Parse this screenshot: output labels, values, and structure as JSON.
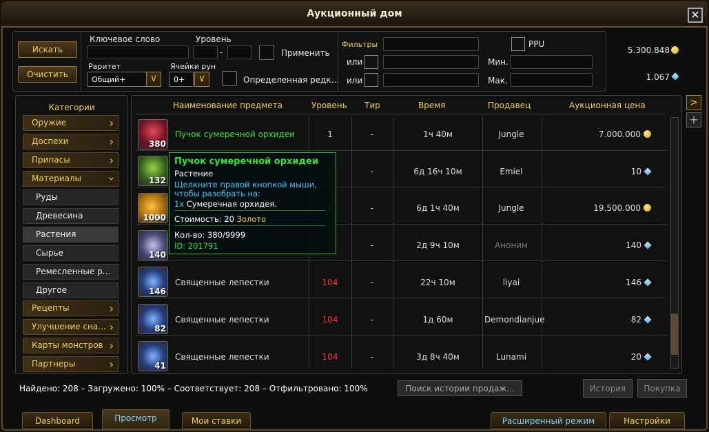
{
  "window": {
    "title": "Аукционный дом"
  },
  "search": {
    "search_btn": "Искать",
    "clear_btn": "Очистить",
    "keyword_label": "Ключевое слово",
    "keyword_value": "",
    "level_label": "Уровень",
    "level_dash": "-",
    "apply_label": "Применить",
    "rarity_label": "Раритет",
    "rarity_value": "Общий+",
    "rune_label": "Ячейки рун",
    "rune_value": "0+",
    "specific_label": "Определенная редк..."
  },
  "filters": {
    "label": "Фильтры",
    "or1": "или",
    "or2": "или",
    "ppu": "PPU",
    "min": "Мин.",
    "max": "Мак."
  },
  "currency": {
    "gold": "5.300.848",
    "gems": "1.067"
  },
  "categories": {
    "title": "Категории",
    "items": [
      {
        "label": "Оружие"
      },
      {
        "label": "Доспехи"
      },
      {
        "label": "Припасы"
      },
      {
        "label": "Материалы"
      }
    ],
    "sub": [
      {
        "label": "Руды"
      },
      {
        "label": "Древесина"
      },
      {
        "label": "Растения"
      },
      {
        "label": "Сырье"
      },
      {
        "label": "Ремесленные р..."
      },
      {
        "label": "Другое"
      }
    ],
    "after": [
      {
        "label": "Рецепты"
      },
      {
        "label": "Улучшение сна..."
      },
      {
        "label": "Карты монстров"
      },
      {
        "label": "Партнеры"
      }
    ]
  },
  "table": {
    "headers": {
      "name": "Наименование предмета",
      "level": "Уровень",
      "tier": "Тир",
      "time": "Время",
      "seller": "Продавец",
      "price": "Аукционная цена"
    },
    "rows": [
      {
        "count": "380",
        "name": "Пучок сумеречной орхидеи",
        "level": "1",
        "tier": "-",
        "time": "1ч 40м",
        "seller": "Jungle",
        "price": "7.000.000",
        "cur": "gold"
      },
      {
        "count": "132",
        "name": "",
        "level": "1",
        "tier": "-",
        "time": "6д 16ч 10м",
        "seller": "Emiel",
        "price": "10",
        "cur": "gem"
      },
      {
        "count": "1000",
        "name": "",
        "level": "1",
        "tier": "-",
        "time": "6д 1ч 40м",
        "seller": "Jungle",
        "price": "19.500.000",
        "cur": "gold"
      },
      {
        "count": "140",
        "name": "",
        "level": "1",
        "tier": "-",
        "time": "2д 9ч 10м",
        "seller": "Аноним",
        "price": "140",
        "cur": "gem"
      },
      {
        "count": "146",
        "name": "Священные лепестки",
        "level": "104",
        "tier": "-",
        "time": "22ч 10м",
        "seller": "liyai",
        "price": "146",
        "cur": "gem"
      },
      {
        "count": "82",
        "name": "Священные лепестки",
        "level": "104",
        "tier": "-",
        "time": "1д 60м",
        "seller": "Demondianjue",
        "price": "82",
        "cur": "gem"
      },
      {
        "count": "41",
        "name": "Священные лепестки",
        "level": "104",
        "tier": "-",
        "time": "3д 8ч 40м",
        "seller": "Lunami",
        "price": "20",
        "cur": "gem"
      }
    ]
  },
  "tooltip": {
    "title": "Пучок сумеречной орхидеи",
    "type": "Растение",
    "hint": "Щелкните правой кнопкой мыши, чтобы разобрать на:",
    "qty": "1x",
    "result": "Сумеречная орхидея.",
    "cost_label": "Стоимость: 20",
    "cost_unit": "Золото",
    "count": "Кол-во: 380/9999",
    "id": "ID: 201791"
  },
  "status": {
    "text": "Найдено: 208 – Загружено: 100% – Соответствует: 208 – Отфильтровано: 100%",
    "history_search": "Поиск истории продаж...",
    "history_btn": "История",
    "buy_btn": "Покупка"
  },
  "tabs": {
    "dashboard": "Dashboard",
    "browse": "Просмотр",
    "bids": "Мои ставки",
    "advanced": "Расширенный режим",
    "settings": "Настройки"
  },
  "colors": {
    "gold_text": "#f0d15a",
    "green_text": "#39e039",
    "red_text": "#ff3a3a",
    "blue_text": "#4fc8ff"
  }
}
